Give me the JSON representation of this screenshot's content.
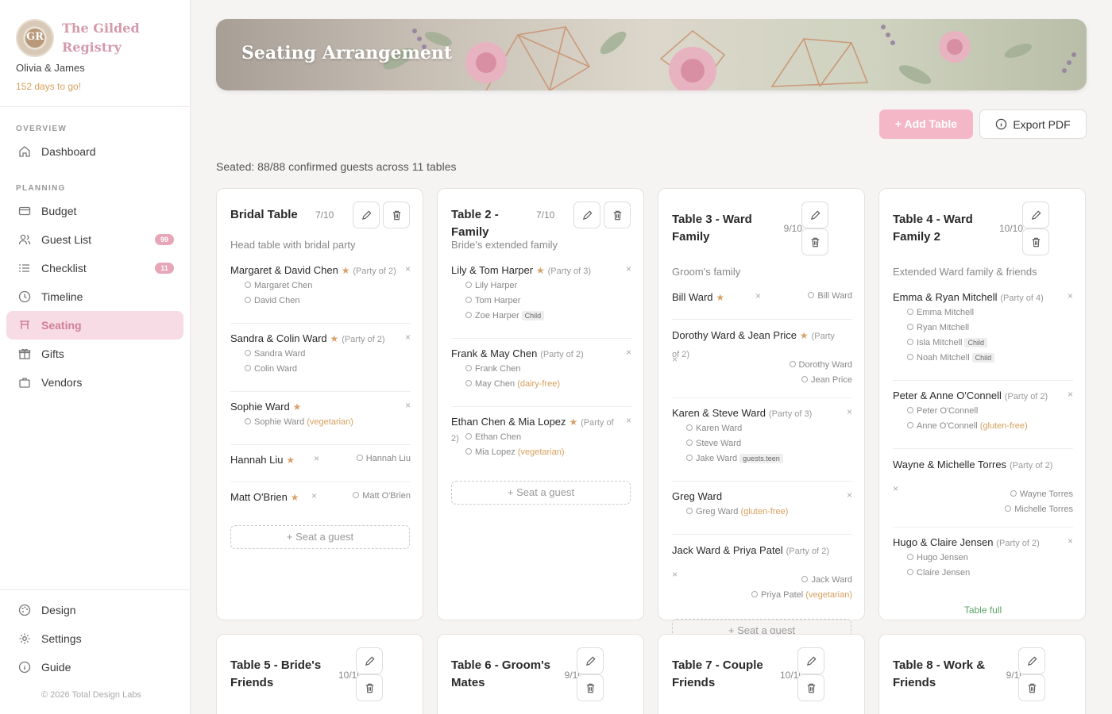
{
  "brand": {
    "name": "The Gilded Registry",
    "monogram": "GR",
    "couple": "Olivia & James",
    "countdown": "152 days to go!"
  },
  "nav": {
    "overview_label": "OVERVIEW",
    "planning_label": "PLANNING",
    "dashboard": "Dashboard",
    "items": [
      {
        "label": "Budget",
        "icon": "wallet-icon"
      },
      {
        "label": "Guest List",
        "icon": "users-icon",
        "badge": "99"
      },
      {
        "label": "Checklist",
        "icon": "list-icon",
        "badge": "11"
      },
      {
        "label": "Timeline",
        "icon": "clock-icon"
      },
      {
        "label": "Seating",
        "icon": "seating-icon",
        "active": true
      },
      {
        "label": "Gifts",
        "icon": "gift-icon"
      },
      {
        "label": "Vendors",
        "icon": "briefcase-icon"
      }
    ],
    "bottom": [
      {
        "label": "Design",
        "icon": "palette-icon"
      },
      {
        "label": "Settings",
        "icon": "gear-icon"
      },
      {
        "label": "Guide",
        "icon": "info-icon"
      }
    ],
    "copyright": "© 2026 Total Design Labs"
  },
  "header": {
    "title": "Seating Arrangement"
  },
  "toolbar": {
    "add_label": "+ Add Table",
    "export_label": "Export PDF"
  },
  "summary": "Seated: 88/88 confirmed guests across 11 tables",
  "tables": [
    {
      "name": "Bridal Table",
      "count": "7/10",
      "desc": "Head table with bridal party",
      "guests": [
        {
          "name": "Margaret & David Chen",
          "star": "★",
          "party": "(Party of 2)",
          "members": [
            {
              "name": "Margaret Chen"
            },
            {
              "name": "David Chen"
            }
          ]
        },
        {
          "name": "Sandra & Colin Ward",
          "star": "★",
          "party": "(Party of 2)",
          "members": [
            {
              "name": "Sandra Ward"
            },
            {
              "name": "Colin Ward"
            }
          ]
        },
        {
          "name": "Sophie Ward",
          "star": "★",
          "members": [
            {
              "name": "Sophie Ward",
              "diet": "(vegetarian)"
            }
          ]
        },
        {
          "name": "Hannah Liu",
          "star": "★",
          "members": [
            {
              "name": "Hannah Liu"
            }
          ]
        },
        {
          "name": "Matt O'Brien",
          "star": "★",
          "members": [
            {
              "name": "Matt O'Brien"
            }
          ]
        }
      ],
      "seat_label": "+ Seat a guest"
    },
    {
      "name": "Table 2 - Family",
      "count": "7/10",
      "desc": "Bride's extended family",
      "guests": [
        {
          "name": "Lily & Tom Harper",
          "star": "★",
          "party": "(Party of 3)",
          "members": [
            {
              "name": "Lily Harper"
            },
            {
              "name": "Tom Harper"
            },
            {
              "name": "Zoe Harper",
              "tag": "Child"
            }
          ]
        },
        {
          "name": "Frank & May Chen",
          "party": "(Party of 2)",
          "members": [
            {
              "name": "Frank Chen"
            },
            {
              "name": "May Chen",
              "diet": "(dairy-free)"
            }
          ]
        },
        {
          "name": "Ethan Chen & Mia Lopez",
          "star": "★",
          "party": "(Party of 2)",
          "members": [
            {
              "name": "Ethan Chen"
            },
            {
              "name": "Mia Lopez",
              "diet": "(vegetarian)"
            }
          ]
        }
      ],
      "seat_label": "+ Seat a guest"
    },
    {
      "name": "Table 3 - Ward Family",
      "count": "9/10",
      "desc": "Groom's family",
      "guests": [
        {
          "name": "Bill Ward",
          "star": "★",
          "members": [
            {
              "name": "Bill Ward"
            }
          ]
        },
        {
          "name": "Dorothy Ward & Jean Price",
          "star": "★",
          "party": "(Party of 2)",
          "members": [
            {
              "name": "Dorothy Ward"
            },
            {
              "name": "Jean Price"
            }
          ]
        },
        {
          "name": "Karen & Steve Ward",
          "party": "(Party of 3)",
          "members": [
            {
              "name": "Karen Ward"
            },
            {
              "name": "Steve Ward"
            },
            {
              "name": "Jake Ward",
              "tag": "guests.teen"
            }
          ]
        },
        {
          "name": "Greg Ward",
          "members": [
            {
              "name": "Greg Ward",
              "diet": "(gluten-free)"
            }
          ]
        },
        {
          "name": "Jack Ward & Priya Patel",
          "party": "(Party of 2)",
          "members": [
            {
              "name": "Jack Ward"
            },
            {
              "name": "Priya Patel",
              "diet": "(vegetarian)"
            }
          ]
        }
      ],
      "seat_label": "+ Seat a guest"
    },
    {
      "name": "Table 4 - Ward Family 2",
      "count": "10/10",
      "desc": "Extended Ward family & friends",
      "guests": [
        {
          "name": "Emma & Ryan Mitchell",
          "party": "(Party of 4)",
          "members": [
            {
              "name": "Emma Mitchell"
            },
            {
              "name": "Ryan Mitchell"
            },
            {
              "name": "Isla Mitchell",
              "tag": "Child"
            },
            {
              "name": "Noah Mitchell",
              "tag": "Child"
            }
          ]
        },
        {
          "name": "Peter & Anne O'Connell",
          "party": "(Party of 2)",
          "members": [
            {
              "name": "Peter O'Connell"
            },
            {
              "name": "Anne O'Connell",
              "diet": "(gluten-free)"
            }
          ]
        },
        {
          "name": "Wayne & Michelle Torres",
          "party": "(Party of 2)",
          "members": [
            {
              "name": "Wayne Torres"
            },
            {
              "name": "Michelle Torres"
            }
          ]
        },
        {
          "name": "Hugo & Claire Jensen",
          "party": "(Party of 2)",
          "members": [
            {
              "name": "Hugo Jensen"
            },
            {
              "name": "Claire Jensen"
            }
          ]
        }
      ],
      "full_label": "Table full"
    },
    {
      "name": "Table 5 - Bride's Friends",
      "count": "10/10"
    },
    {
      "name": "Table 6 - Groom's Mates",
      "count": "9/10"
    },
    {
      "name": "Table 7 - Couple Friends",
      "count": "10/10"
    },
    {
      "name": "Table 8 - Work & Friends",
      "count": "9/10"
    }
  ],
  "colors": {
    "accent": "#d17f98",
    "accent_bg": "#f7dce5",
    "add_button": "#f3b7c8",
    "star": "#d8a169",
    "diet": "#d6a05e",
    "full": "#5aa469"
  },
  "x_mark": "×",
  "icons": {
    "edit": "pencil-icon",
    "delete": "trash-icon",
    "export": "info-icon"
  }
}
